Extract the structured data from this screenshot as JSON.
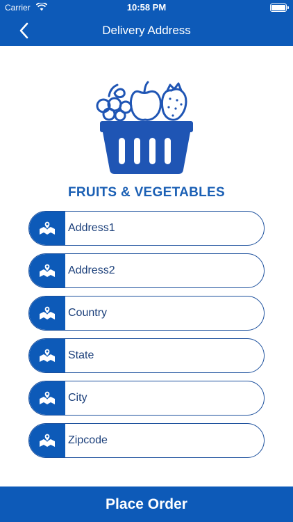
{
  "status_bar": {
    "carrier": "Carrier",
    "time": "10:58 PM"
  },
  "nav": {
    "title": "Delivery Address",
    "back_icon": "chevron-left-icon"
  },
  "brand": {
    "title": "FRUITS & VEGETABLES",
    "logo_icon": "fruit-basket-icon"
  },
  "form": {
    "fields": [
      {
        "placeholder": "Address1",
        "icon": "map-pin-icon"
      },
      {
        "placeholder": "Address2",
        "icon": "map-pin-icon"
      },
      {
        "placeholder": "Country",
        "icon": "map-pin-icon"
      },
      {
        "placeholder": "State",
        "icon": "map-pin-icon"
      },
      {
        "placeholder": "City",
        "icon": "map-pin-icon"
      },
      {
        "placeholder": "Zipcode",
        "icon": "map-pin-icon"
      }
    ]
  },
  "actions": {
    "place_order_label": "Place Order"
  },
  "colors": {
    "primary": "#0d5ab8",
    "text": "#1b3f7a",
    "outline": "#1b4f9c"
  }
}
